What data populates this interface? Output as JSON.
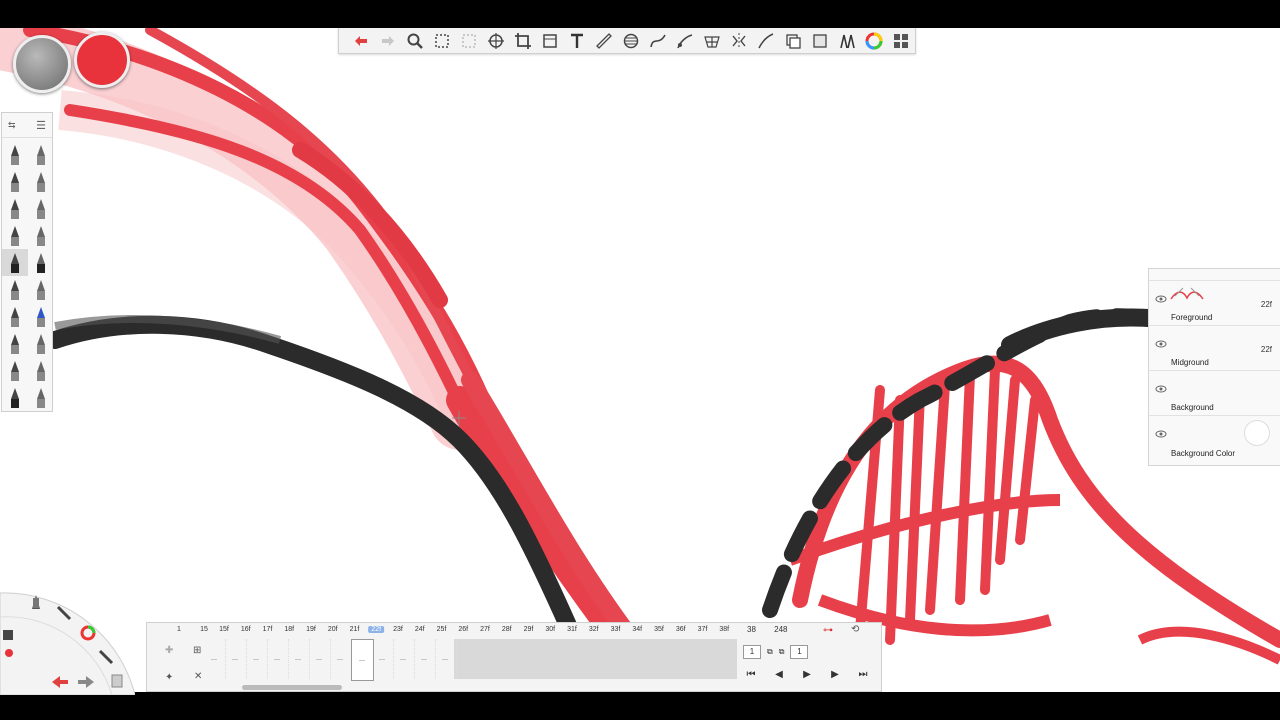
{
  "toolbar": {
    "icons": [
      "undo-icon",
      "redo-icon",
      "zoom-icon",
      "select-rect-icon",
      "select-lasso-icon",
      "transform-icon",
      "crop-icon",
      "canvas-icon",
      "text-icon",
      "ruler-icon",
      "ellipse-icon",
      "french-curve-icon",
      "perspective-icon",
      "symmetry-icon",
      "stroke-icon",
      "copy-icon",
      "layer-editor-icon",
      "brush-editor-icon",
      "color-wheel-icon",
      "flipbook-icon"
    ]
  },
  "brush_palette": {
    "rows": 10,
    "selected_index": 8
  },
  "layers": [
    {
      "name": "Foreground",
      "frames": "22f"
    },
    {
      "name": "Midground",
      "frames": "22f"
    },
    {
      "name": "Background",
      "frames": ""
    },
    {
      "name": "Background Color",
      "frames": ""
    }
  ],
  "timeline": {
    "start_frame": "1",
    "view_start": "15",
    "frame_labels": [
      "15f",
      "16f",
      "17f",
      "18f",
      "19f",
      "20f",
      "21f",
      "22f",
      "23f",
      "24f",
      "25f",
      "26f",
      "27f",
      "28f",
      "29f",
      "30f",
      "31f",
      "32f",
      "33f",
      "34f",
      "35f",
      "36f",
      "37f",
      "38f"
    ],
    "current_frame": "22f",
    "end_value": "38",
    "total_frames": "248",
    "hold_value": "1",
    "step_value": "1"
  },
  "colors": {
    "accent_red": "#e8323c",
    "ink": "#333333",
    "panel": "#f4f4f4"
  }
}
